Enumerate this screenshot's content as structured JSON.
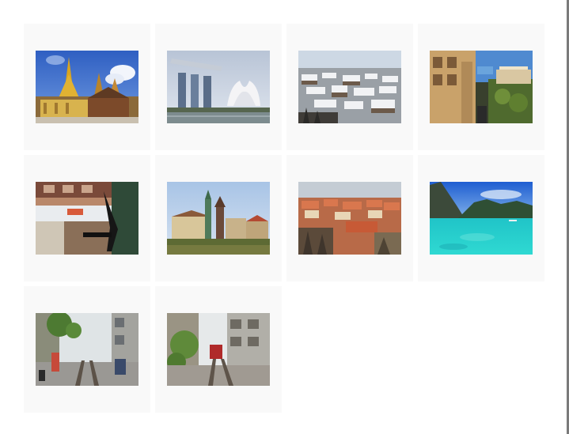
{
  "gallery": {
    "images": [
      {
        "subject": "thai-temple"
      },
      {
        "subject": "marina-bay-sands"
      },
      {
        "subject": "snowy-rooftops"
      },
      {
        "subject": "cliffside-town"
      },
      {
        "subject": "rotated-street"
      },
      {
        "subject": "castle-hill"
      },
      {
        "subject": "red-roof-city"
      },
      {
        "subject": "tropical-lagoon"
      },
      {
        "subject": "train-street-1"
      },
      {
        "subject": "train-street-2"
      }
    ]
  }
}
